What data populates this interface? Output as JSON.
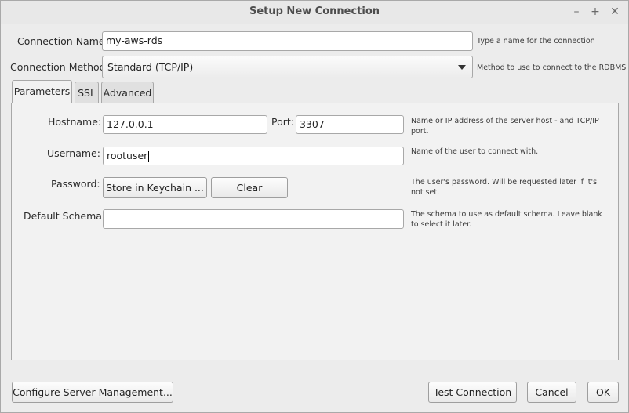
{
  "window": {
    "title": "Setup New Connection",
    "controls": {
      "minimize": "–",
      "maximize": "+",
      "close": "✕"
    }
  },
  "connection_name": {
    "label": "Connection Name:",
    "value": "my-aws-rds",
    "hint": "Type a name for the connection"
  },
  "connection_method": {
    "label": "Connection Method:",
    "value": "Standard (TCP/IP)",
    "hint": "Method to use to connect to the RDBMS"
  },
  "tabs": [
    {
      "label": "Parameters",
      "active": true
    },
    {
      "label": "SSL",
      "active": false
    },
    {
      "label": "Advanced",
      "active": false
    }
  ],
  "parameters": {
    "hostname": {
      "label": "Hostname:",
      "value": "127.0.0.1",
      "hint": "Name or IP address of the server host - and TCP/IP port."
    },
    "port": {
      "label": "Port:",
      "value": "3307"
    },
    "username": {
      "label": "Username:",
      "value": "rootuser",
      "hint": "Name of the user to connect with."
    },
    "password": {
      "label": "Password:",
      "store_button": "Store in Keychain ...",
      "clear_button": "Clear",
      "hint": "The user's password. Will be requested later if it's not set."
    },
    "default_schema": {
      "label": "Default Schema:",
      "value": "",
      "hint": "The schema to use as default schema. Leave blank to select it later."
    }
  },
  "footer": {
    "configure_button": "Configure Server Management...",
    "test_button": "Test Connection",
    "cancel_button": "Cancel",
    "ok_button": "OK"
  }
}
